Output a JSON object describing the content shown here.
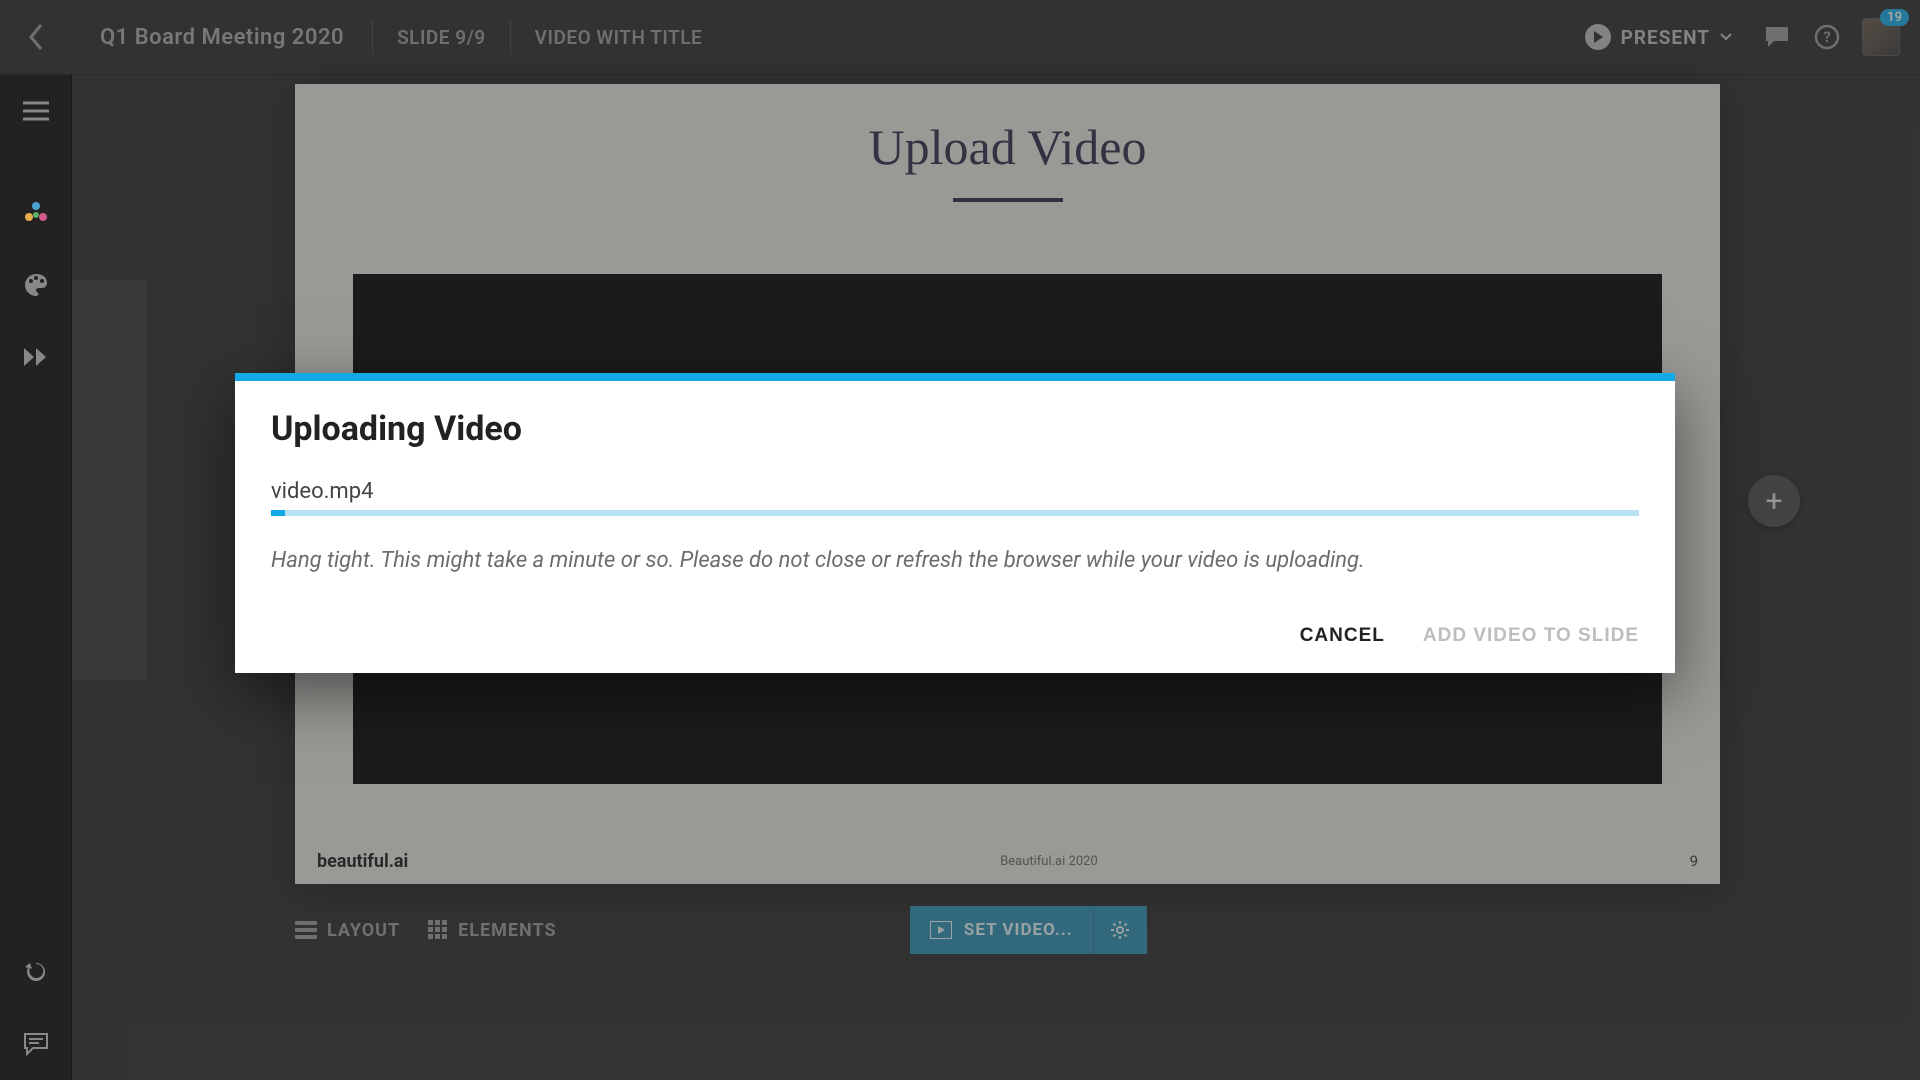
{
  "header": {
    "presentation_title": "Q1 Board Meeting 2020",
    "slide_indicator": "SLIDE 9/9",
    "slide_template": "VIDEO WITH TITLE",
    "present_label": "PRESENT",
    "notification_count": "19"
  },
  "slide": {
    "title": "Upload Video",
    "footer_logo": "beautiful.ai",
    "footer_mid": "Beautiful.ai 2020",
    "footer_page": "9"
  },
  "toolbar": {
    "layout_label": "LAYOUT",
    "elements_label": "ELEMENTS",
    "set_video_label": "SET VIDEO..."
  },
  "modal": {
    "title": "Uploading Video",
    "filename": "video.mp4",
    "progress_percent": 1,
    "hint": "Hang tight. This might take a minute or so. Please do not close or refresh the browser while your video is uploading.",
    "cancel_label": "CANCEL",
    "confirm_label": "ADD VIDEO TO SLIDE"
  }
}
